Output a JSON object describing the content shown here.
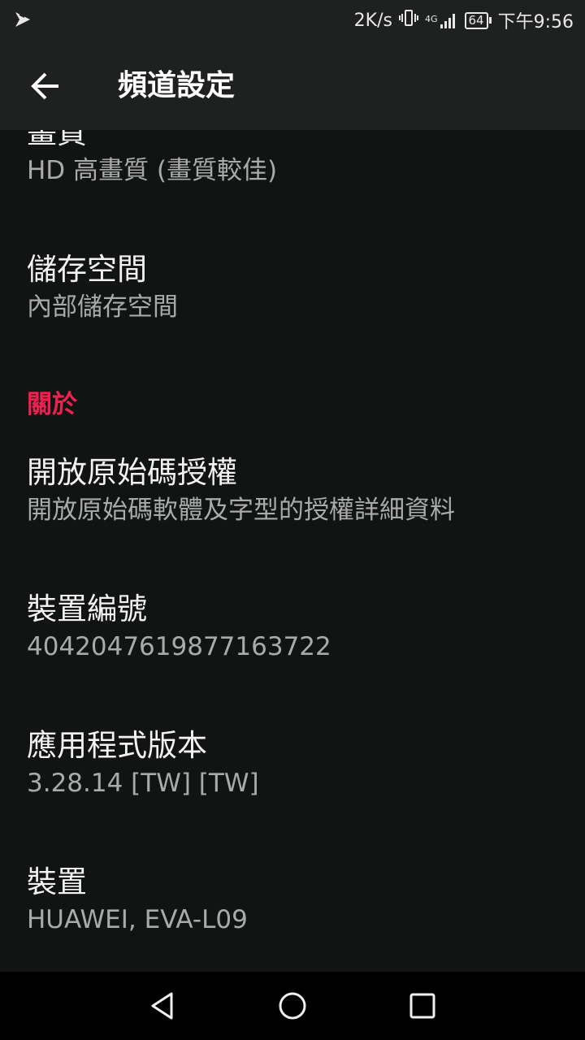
{
  "status_bar": {
    "net_speed": "2K/s",
    "network": "4G",
    "battery": "64",
    "time": "下午9:56"
  },
  "app_bar": {
    "title": "頻道設定"
  },
  "settings": {
    "quality": {
      "title": "畫質",
      "summary": "HD 高畫質 (畫質較佳)"
    },
    "storage": {
      "title": "儲存空間",
      "summary": "內部儲存空間"
    },
    "about_header": "關於",
    "open_source": {
      "title": "開放原始碼授權",
      "summary": "開放原始碼軟體及字型的授權詳細資料"
    },
    "device_id": {
      "title": "裝置編號",
      "summary": "4042047619877163722"
    },
    "app_version": {
      "title": "應用程式版本",
      "summary": "3.28.14 [TW] [TW]"
    },
    "device": {
      "title": "裝置",
      "summary": "HUAWEI, EVA-L09"
    }
  },
  "colors": {
    "accent": "#e8234f",
    "background": "#121313",
    "toolbar": "#1f2020"
  },
  "icons": {
    "back": "arrow-back-icon",
    "nav_back": "triangle-back-icon",
    "nav_home": "circle-home-icon",
    "nav_recents": "square-recents-icon"
  }
}
